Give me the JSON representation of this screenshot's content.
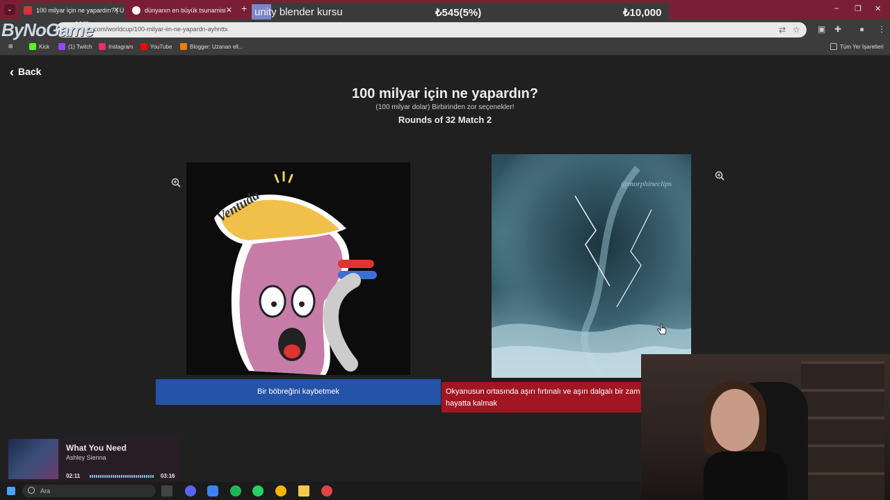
{
  "browser": {
    "tabs": [
      {
        "title": "100 milyar için ne yapardın? | U",
        "active": true,
        "favicon_color": "#d9303a"
      },
      {
        "title": "dünyanın en büyük tsunamisi -",
        "active": false,
        "favicon_color": "#ffffff"
      }
    ],
    "new_tab_label": "+",
    "url": "ufu.com/worldcup/100-milyar-iin-ne-yapardn-ayhnttx",
    "window_controls": [
      "–",
      "❐",
      "✕"
    ]
  },
  "ticker": {
    "item1": "unity blender kursu",
    "item2": "₺545(5%)",
    "item3": "₺10,000"
  },
  "overlay_logo": {
    "main": "ByNoGame",
    "sub": ".com"
  },
  "bookmarks": [
    {
      "label": "Kick",
      "color": "#53fc18"
    },
    {
      "label": "(1) Twitch",
      "color": "#9146ff"
    },
    {
      "label": "Instagram",
      "color": "#e1306c"
    },
    {
      "label": "YouTube",
      "color": "#ff0000"
    },
    {
      "label": "Blogger: Uzanan ell...",
      "color": "#f57d00"
    }
  ],
  "bookmarks_right": "Tüm Yer İşaretleri",
  "page": {
    "back_label": "Back",
    "title": "100 milyar için ne yapardın?",
    "subtitle": "(100 milyar dolar) Birbirinden zor seçenekler!",
    "round": "Rounds of 32 Match 2",
    "options": [
      {
        "label": "Bir böbreğini kaybetmek",
        "color": "#2453a8"
      },
      {
        "label": "Okyanusun ortasında aşırı fırtınalı ve aşırı dalgalı bir zam hayatta kalmak",
        "color": "#a11622"
      }
    ],
    "left_image_text": "Ventuda",
    "right_image_watermark": "@morphineclips"
  },
  "music": {
    "song": "What You Need",
    "artist": "Ashley Sienna",
    "elapsed": "02:11",
    "total": "03:16"
  },
  "taskbar": {
    "search_placeholder": "Ara"
  }
}
